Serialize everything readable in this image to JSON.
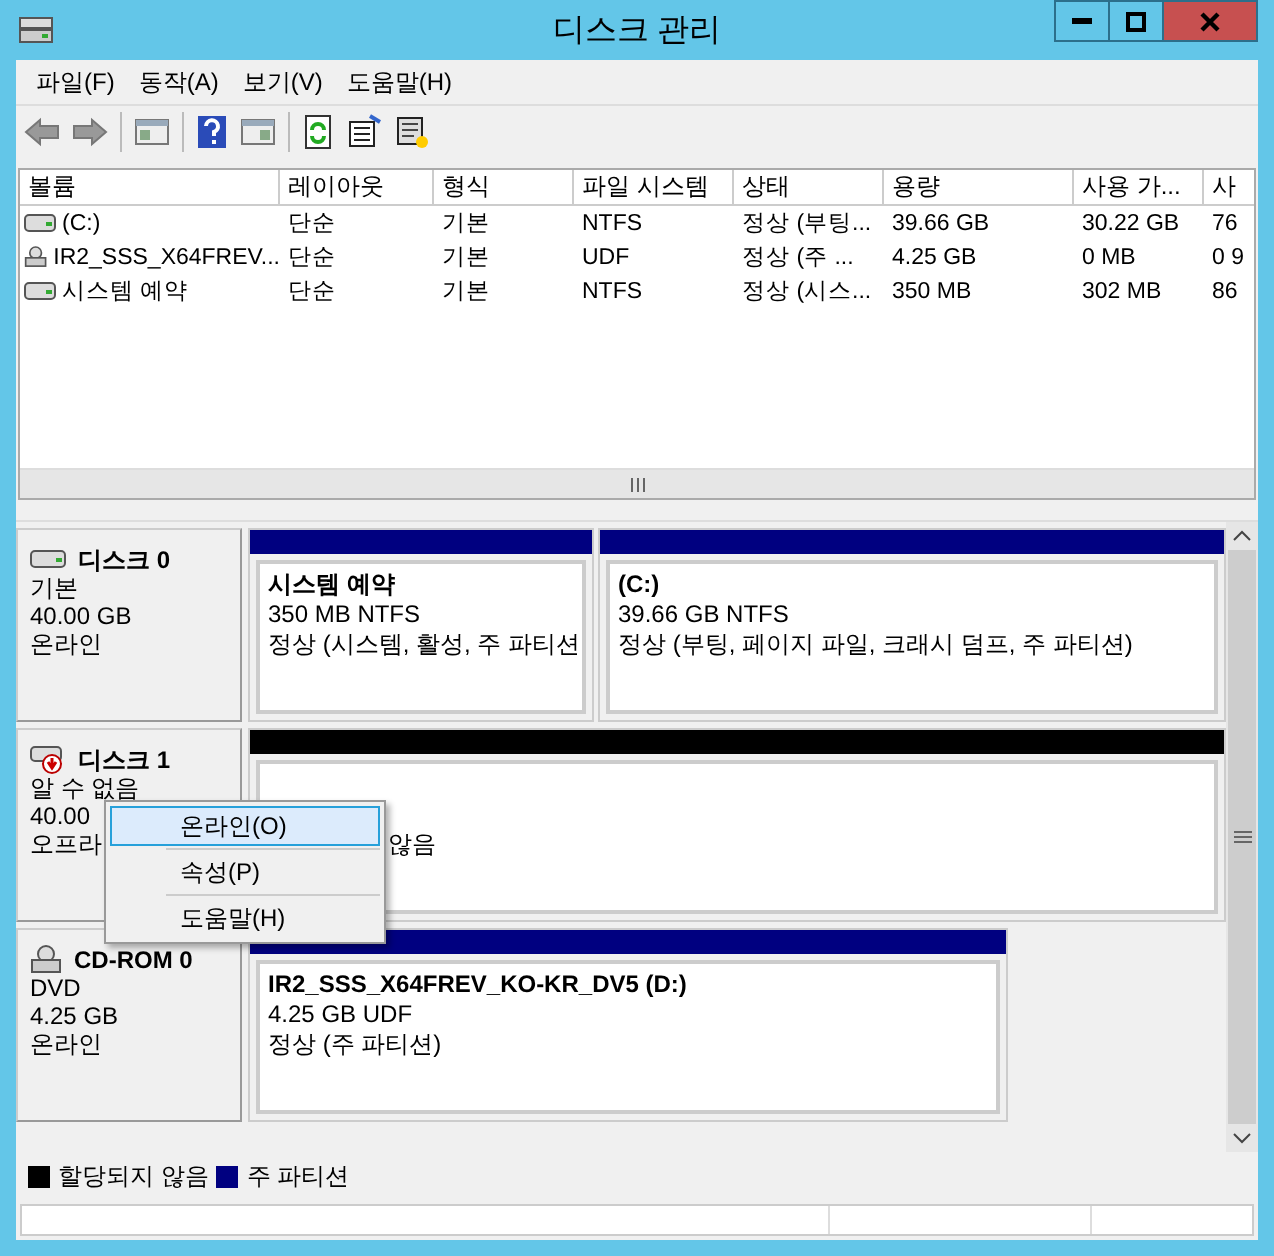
{
  "window": {
    "title": "디스크 관리"
  },
  "menu": [
    "파일(F)",
    "동작(A)",
    "보기(V)",
    "도움말(H)"
  ],
  "volumes": {
    "columns": [
      "볼륨",
      "레이아웃",
      "형식",
      "파일 시스템",
      "상태",
      "용량",
      "사용 가...",
      "사"
    ],
    "rows": [
      {
        "kind": "disk",
        "cells": [
          "(C:)",
          "단순",
          "기본",
          "NTFS",
          "정상 (부팅...",
          "39.66 GB",
          "30.22 GB",
          "76"
        ]
      },
      {
        "kind": "cd",
        "cells": [
          "IR2_SSS_X64FREV...",
          "단순",
          "기본",
          "UDF",
          "정상 (주 ...",
          "4.25 GB",
          "0 MB",
          "0 9"
        ]
      },
      {
        "kind": "disk",
        "cells": [
          "시스템 예약",
          "단순",
          "기본",
          "NTFS",
          "정상 (시스...",
          "350 MB",
          "302 MB",
          "86"
        ]
      }
    ]
  },
  "disks": [
    {
      "kind": "disk",
      "name": "디스크 0",
      "lines": [
        "기본",
        "40.00 GB",
        "온라인"
      ],
      "partitions": [
        {
          "kind": "primary",
          "name": "시스템 예약",
          "lines": [
            "350 MB NTFS",
            "정상 (시스템, 활성, 주 파티션"
          ]
        },
        {
          "kind": "primary",
          "name": "(C:)",
          "lines": [
            "39.66 GB NTFS",
            "정상 (부팅, 페이지 파일, 크래시 덤프, 주 파티션)"
          ]
        }
      ]
    },
    {
      "kind": "offline",
      "name": "디스크 1",
      "lines": [
        "알 수 없음",
        "40.00",
        "오프라"
      ],
      "partitions": [
        {
          "kind": "unallocated",
          "lines": [
            "않음"
          ]
        }
      ]
    },
    {
      "kind": "cd",
      "name": "CD-ROM 0",
      "lines": [
        "DVD",
        "4.25 GB",
        "온라인"
      ],
      "partitions": [
        {
          "kind": "primary",
          "name": "IR2_SSS_X64FREV_KO-KR_DV5   (D:)",
          "lines": [
            "4.25 GB UDF",
            "정상 (주 파티션)"
          ]
        }
      ]
    }
  ],
  "context_menu": [
    {
      "label": "온라인(O)",
      "selected": true
    },
    {
      "label": "속성(P)",
      "selected": false
    },
    {
      "label": "도움말(H)",
      "selected": false
    }
  ],
  "legend": [
    {
      "label": "할당되지 않음",
      "color": "#000000"
    },
    {
      "label": "주 파티션",
      "color": "#000080"
    }
  ]
}
